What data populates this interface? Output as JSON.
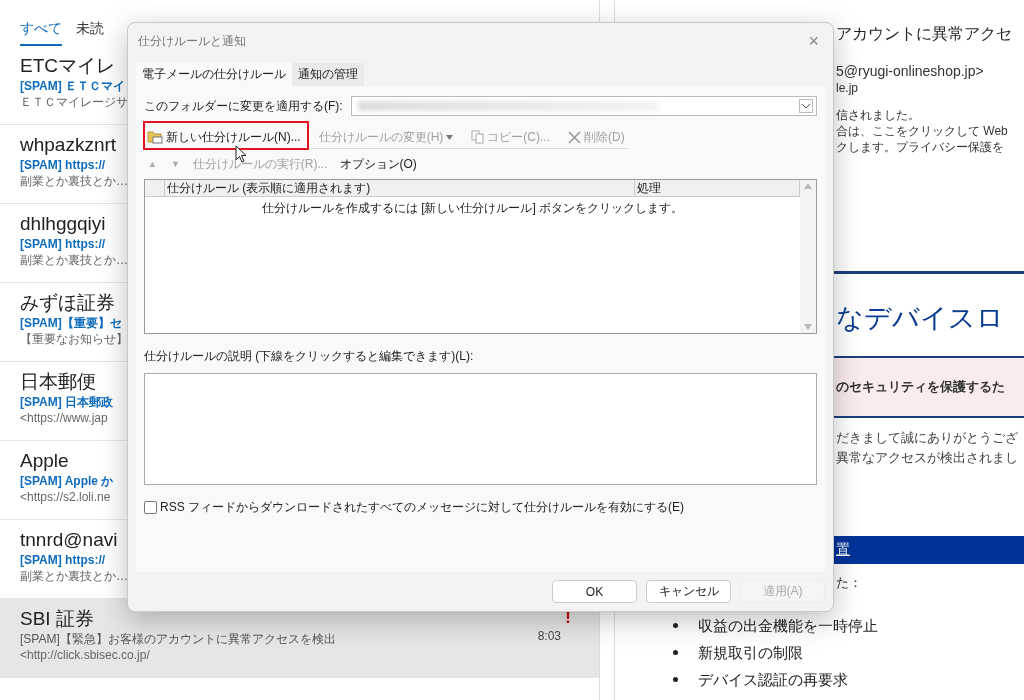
{
  "mail_list": {
    "tabs": [
      {
        "label": "すべて",
        "selected": true
      },
      {
        "label": "未読",
        "selected": false
      }
    ],
    "messages": [
      {
        "sender": "ETCマイレ",
        "subject": "[SPAM] ＥＴＣマイ",
        "preview": "ＥＴＣマイレージサ",
        "unread": true,
        "selected": false
      },
      {
        "sender": "whpazkznrt",
        "subject": "[SPAM] https://",
        "preview": "副業とか裏技とか…",
        "unread": true,
        "selected": false
      },
      {
        "sender": "dhlhggqiyi",
        "subject": "[SPAM] https://",
        "preview": "副業とか裏技とか…",
        "unread": true,
        "selected": false
      },
      {
        "sender": "みずほ証券",
        "subject": "[SPAM]【重要】セ",
        "preview": "【重要なお知らせ】",
        "unread": true,
        "selected": false
      },
      {
        "sender": "日本郵便",
        "subject": "[SPAM] 日本郵政",
        "preview": "<https://www.jap",
        "unread": true,
        "selected": false
      },
      {
        "sender": "Apple",
        "subject": "[SPAM] Apple か",
        "preview": "<https://s2.loli.ne",
        "unread": true,
        "selected": false
      },
      {
        "sender": "tnnrd@navi",
        "subject": "[SPAM] https://",
        "preview": "副業とか裏技とか…",
        "unread": true,
        "selected": false
      },
      {
        "sender": "SBI 証券",
        "subject": "[SPAM]【緊急】お客様のアカウントに異常アクセスを検出",
        "preview": "<http://click.sbisec.co.jp/",
        "time": "8:03",
        "flag": "!",
        "unread": false,
        "selected": true
      }
    ]
  },
  "reading_pane": {
    "title": "アカウントに異常アクセ",
    "from": "5@ryugi-onlineshop.jp>",
    "to": "le.jp",
    "notice_lines": [
      "信されました。",
      "合は、ここをクリックして Web",
      "クします。プライバシー保護を"
    ],
    "heading": "なデバイスロ",
    "alert": "のセキュリティを保護するた",
    "body_lines": [
      "だきまして誠にありがとうござ",
      "異常なアクセスが検出されまし"
    ],
    "section_bar": "置",
    "section_text": "た：",
    "bullets": [
      "収益の出金機能を一時停止",
      "新規取引の制限",
      "デバイス認証の再要求"
    ]
  },
  "dialog": {
    "title": "仕分けルールと通知",
    "close": "×",
    "tabs": [
      {
        "label": "電子メールの仕分けルール",
        "selected": true
      },
      {
        "label": "通知の管理",
        "selected": false
      }
    ],
    "folder_label": "このフォルダーに変更を適用する(F):",
    "toolbar": [
      {
        "label": "新しい仕分けルール(N)...",
        "disabled": false,
        "highlighted": true
      },
      {
        "label": "仕分けルールの変更(H)",
        "disabled": true,
        "highlighted": false
      },
      {
        "label": "コピー(C)...",
        "disabled": true,
        "highlighted": false
      },
      {
        "label": "削除(D)",
        "disabled": true,
        "highlighted": false
      }
    ],
    "toolbar2": [
      {
        "label": "▲",
        "kind": "arrow",
        "disabled": true
      },
      {
        "label": "▼",
        "kind": "arrow",
        "disabled": true
      },
      {
        "label": "仕分けルールの実行(R)...",
        "kind": "text",
        "disabled": true
      },
      {
        "label": "オプション(O)",
        "kind": "text",
        "disabled": false
      }
    ],
    "columns": [
      "仕分けルール (表示順に適用されます)",
      "処理"
    ],
    "empty_message": "仕分けルールを作成するには [新しい仕分けルール] ボタンをクリックします。",
    "description_label": "仕分けルールの説明 (下線をクリックすると編集できます)(L):",
    "rss_checkbox": {
      "label": "RSS フィードからダウンロードされたすべてのメッセージに対して仕分けルールを有効にする(E)",
      "checked": false
    },
    "buttons": [
      {
        "label": "OK",
        "disabled": false
      },
      {
        "label": "キャンセル",
        "disabled": false
      },
      {
        "label": "適用(A)",
        "disabled": true
      }
    ]
  }
}
